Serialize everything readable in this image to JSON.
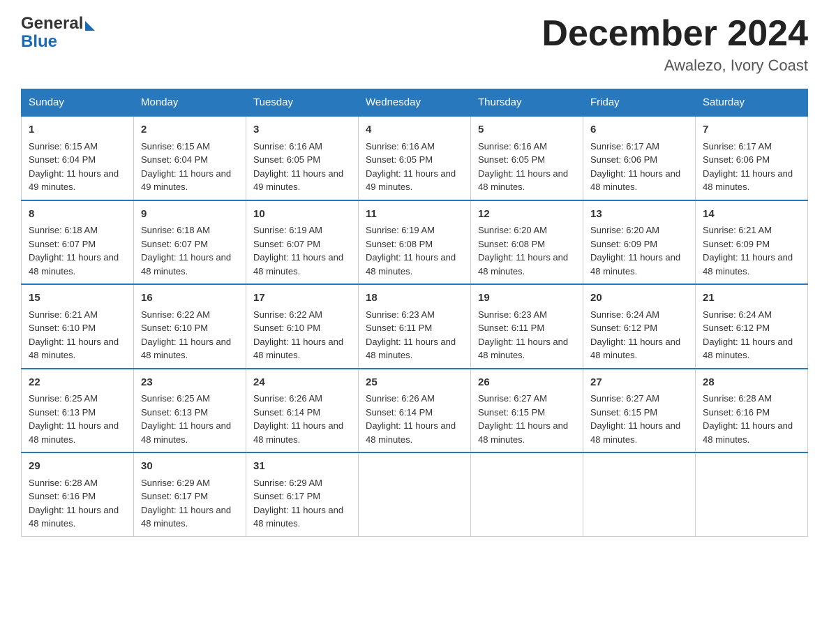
{
  "logo": {
    "general": "General",
    "blue": "Blue"
  },
  "header": {
    "month_year": "December 2024",
    "location": "Awalezo, Ivory Coast"
  },
  "days_of_week": [
    "Sunday",
    "Monday",
    "Tuesday",
    "Wednesday",
    "Thursday",
    "Friday",
    "Saturday"
  ],
  "weeks": [
    [
      {
        "day": "1",
        "sunrise": "6:15 AM",
        "sunset": "6:04 PM",
        "daylight": "11 hours and 49 minutes."
      },
      {
        "day": "2",
        "sunrise": "6:15 AM",
        "sunset": "6:04 PM",
        "daylight": "11 hours and 49 minutes."
      },
      {
        "day": "3",
        "sunrise": "6:16 AM",
        "sunset": "6:05 PM",
        "daylight": "11 hours and 49 minutes."
      },
      {
        "day": "4",
        "sunrise": "6:16 AM",
        "sunset": "6:05 PM",
        "daylight": "11 hours and 49 minutes."
      },
      {
        "day": "5",
        "sunrise": "6:16 AM",
        "sunset": "6:05 PM",
        "daylight": "11 hours and 48 minutes."
      },
      {
        "day": "6",
        "sunrise": "6:17 AM",
        "sunset": "6:06 PM",
        "daylight": "11 hours and 48 minutes."
      },
      {
        "day": "7",
        "sunrise": "6:17 AM",
        "sunset": "6:06 PM",
        "daylight": "11 hours and 48 minutes."
      }
    ],
    [
      {
        "day": "8",
        "sunrise": "6:18 AM",
        "sunset": "6:07 PM",
        "daylight": "11 hours and 48 minutes."
      },
      {
        "day": "9",
        "sunrise": "6:18 AM",
        "sunset": "6:07 PM",
        "daylight": "11 hours and 48 minutes."
      },
      {
        "day": "10",
        "sunrise": "6:19 AM",
        "sunset": "6:07 PM",
        "daylight": "11 hours and 48 minutes."
      },
      {
        "day": "11",
        "sunrise": "6:19 AM",
        "sunset": "6:08 PM",
        "daylight": "11 hours and 48 minutes."
      },
      {
        "day": "12",
        "sunrise": "6:20 AM",
        "sunset": "6:08 PM",
        "daylight": "11 hours and 48 minutes."
      },
      {
        "day": "13",
        "sunrise": "6:20 AM",
        "sunset": "6:09 PM",
        "daylight": "11 hours and 48 minutes."
      },
      {
        "day": "14",
        "sunrise": "6:21 AM",
        "sunset": "6:09 PM",
        "daylight": "11 hours and 48 minutes."
      }
    ],
    [
      {
        "day": "15",
        "sunrise": "6:21 AM",
        "sunset": "6:10 PM",
        "daylight": "11 hours and 48 minutes."
      },
      {
        "day": "16",
        "sunrise": "6:22 AM",
        "sunset": "6:10 PM",
        "daylight": "11 hours and 48 minutes."
      },
      {
        "day": "17",
        "sunrise": "6:22 AM",
        "sunset": "6:10 PM",
        "daylight": "11 hours and 48 minutes."
      },
      {
        "day": "18",
        "sunrise": "6:23 AM",
        "sunset": "6:11 PM",
        "daylight": "11 hours and 48 minutes."
      },
      {
        "day": "19",
        "sunrise": "6:23 AM",
        "sunset": "6:11 PM",
        "daylight": "11 hours and 48 minutes."
      },
      {
        "day": "20",
        "sunrise": "6:24 AM",
        "sunset": "6:12 PM",
        "daylight": "11 hours and 48 minutes."
      },
      {
        "day": "21",
        "sunrise": "6:24 AM",
        "sunset": "6:12 PM",
        "daylight": "11 hours and 48 minutes."
      }
    ],
    [
      {
        "day": "22",
        "sunrise": "6:25 AM",
        "sunset": "6:13 PM",
        "daylight": "11 hours and 48 minutes."
      },
      {
        "day": "23",
        "sunrise": "6:25 AM",
        "sunset": "6:13 PM",
        "daylight": "11 hours and 48 minutes."
      },
      {
        "day": "24",
        "sunrise": "6:26 AM",
        "sunset": "6:14 PM",
        "daylight": "11 hours and 48 minutes."
      },
      {
        "day": "25",
        "sunrise": "6:26 AM",
        "sunset": "6:14 PM",
        "daylight": "11 hours and 48 minutes."
      },
      {
        "day": "26",
        "sunrise": "6:27 AM",
        "sunset": "6:15 PM",
        "daylight": "11 hours and 48 minutes."
      },
      {
        "day": "27",
        "sunrise": "6:27 AM",
        "sunset": "6:15 PM",
        "daylight": "11 hours and 48 minutes."
      },
      {
        "day": "28",
        "sunrise": "6:28 AM",
        "sunset": "6:16 PM",
        "daylight": "11 hours and 48 minutes."
      }
    ],
    [
      {
        "day": "29",
        "sunrise": "6:28 AM",
        "sunset": "6:16 PM",
        "daylight": "11 hours and 48 minutes."
      },
      {
        "day": "30",
        "sunrise": "6:29 AM",
        "sunset": "6:17 PM",
        "daylight": "11 hours and 48 minutes."
      },
      {
        "day": "31",
        "sunrise": "6:29 AM",
        "sunset": "6:17 PM",
        "daylight": "11 hours and 48 minutes."
      },
      null,
      null,
      null,
      null
    ]
  ],
  "labels": {
    "sunrise": "Sunrise:",
    "sunset": "Sunset:",
    "daylight": "Daylight:"
  }
}
